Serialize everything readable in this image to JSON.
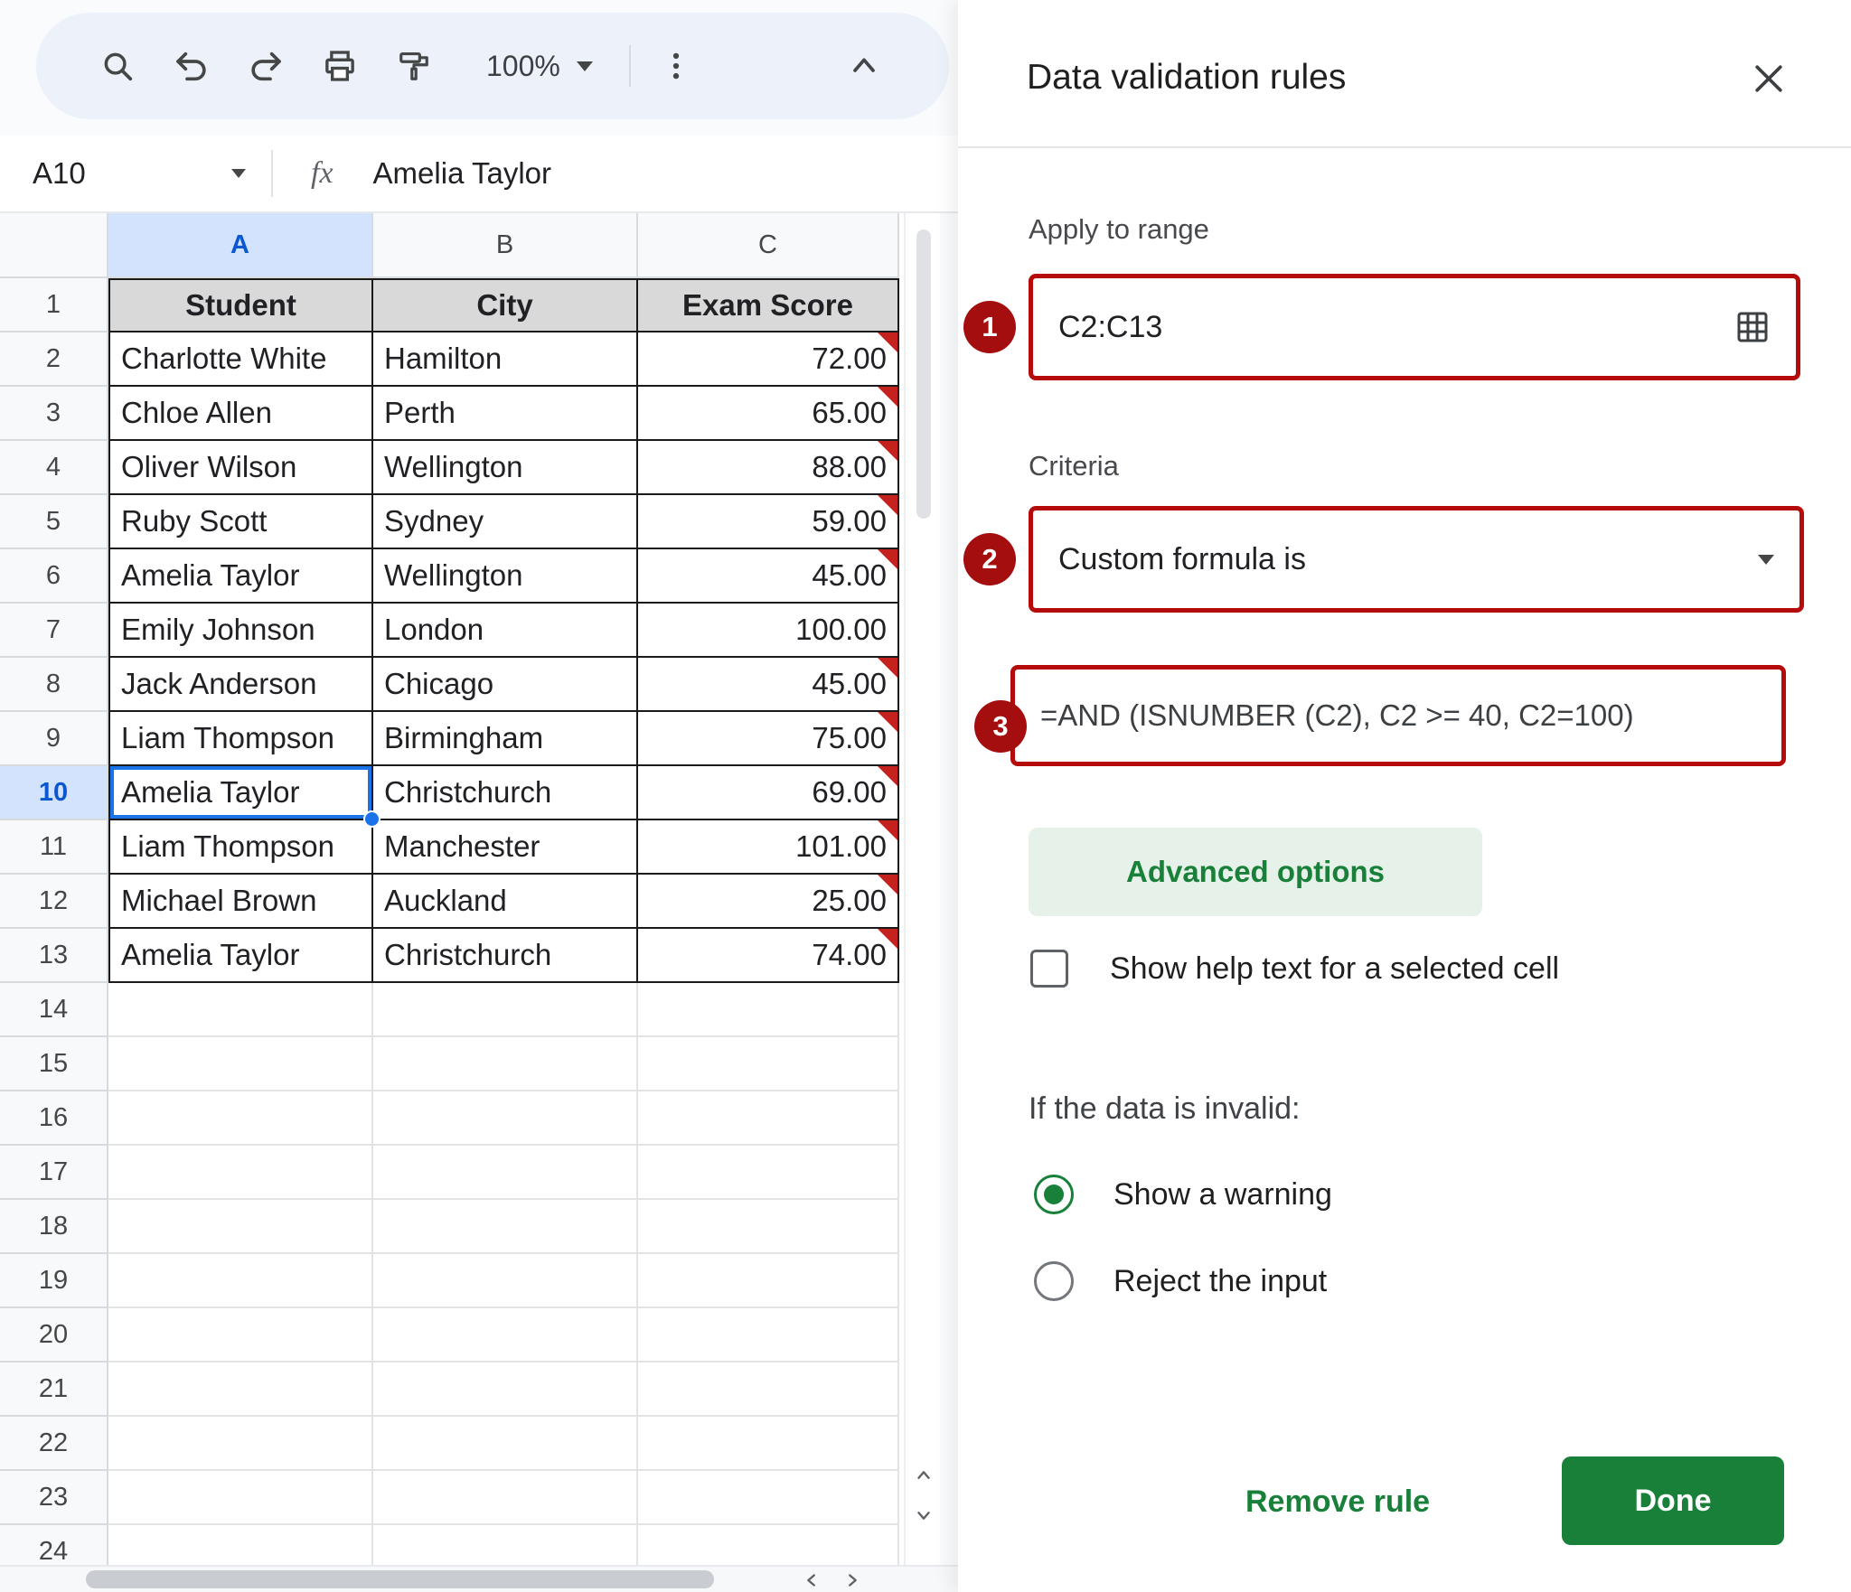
{
  "toolbar": {
    "zoom_value": "100%",
    "icons": [
      "search-icon",
      "undo-icon",
      "redo-icon",
      "print-icon",
      "paint-format-icon",
      "more-options-icon",
      "collapse-toolbar-icon"
    ]
  },
  "formula_bar": {
    "name_box": "A10",
    "fx_label": "fx",
    "value": "Amelia Taylor"
  },
  "sheet": {
    "col_letters": [
      "A",
      "B",
      "C"
    ],
    "header_row": [
      "Student",
      "City",
      "Exam Score"
    ],
    "visible_rows": 24,
    "selected": {
      "row": 10,
      "col": "A"
    },
    "records": [
      {
        "row": 2,
        "student": "Charlotte White",
        "city": "Hamilton",
        "score": "72.00",
        "invalid": true
      },
      {
        "row": 3,
        "student": "Chloe Allen",
        "city": "Perth",
        "score": "65.00",
        "invalid": true
      },
      {
        "row": 4,
        "student": "Oliver Wilson",
        "city": "Wellington",
        "score": "88.00",
        "invalid": true
      },
      {
        "row": 5,
        "student": "Ruby Scott",
        "city": "Sydney",
        "score": "59.00",
        "invalid": true
      },
      {
        "row": 6,
        "student": "Amelia Taylor",
        "city": "Wellington",
        "score": "45.00",
        "invalid": true
      },
      {
        "row": 7,
        "student": "Emily Johnson",
        "city": "London",
        "score": "100.00",
        "invalid": false
      },
      {
        "row": 8,
        "student": "Jack Anderson",
        "city": "Chicago",
        "score": "45.00",
        "invalid": true
      },
      {
        "row": 9,
        "student": "Liam Thompson",
        "city": "Birmingham",
        "score": "75.00",
        "invalid": true
      },
      {
        "row": 10,
        "student": "Amelia Taylor",
        "city": "Christchurch",
        "score": "69.00",
        "invalid": true
      },
      {
        "row": 11,
        "student": "Liam Thompson",
        "city": "Manchester",
        "score": "101.00",
        "invalid": true
      },
      {
        "row": 12,
        "student": "Michael Brown",
        "city": "Auckland",
        "score": "25.00",
        "invalid": true
      },
      {
        "row": 13,
        "student": "Amelia Taylor",
        "city": "Christchurch",
        "score": "74.00",
        "invalid": true
      }
    ]
  },
  "panel": {
    "title": "Data validation rules",
    "apply_label": "Apply to range",
    "range_value": "C2:C13",
    "criteria_label": "Criteria",
    "criteria_value": "Custom formula is",
    "formula_value": "=AND (ISNUMBER (C2), C2 >= 40, C2=100)",
    "advanced_options_label": "Advanced options",
    "help_checkbox_label": "Show help text for a selected cell",
    "invalid_heading": "If the data is invalid:",
    "option_warning": "Show a warning",
    "option_reject": "Reject the input",
    "remove_rule_label": "Remove rule",
    "done_label": "Done",
    "annotations": {
      "step1": "1",
      "step2": "2",
      "step3": "3"
    }
  },
  "colors": {
    "accent_green": "#188038",
    "annotation_red": "#b50b0b",
    "badge_red": "#a50e0e",
    "selection_blue": "#1a73e8",
    "invalid_marker_red": "#c5221f",
    "header_fill_gray": "#d9d9d9",
    "selected_header_blue": "#d3e3fd"
  }
}
